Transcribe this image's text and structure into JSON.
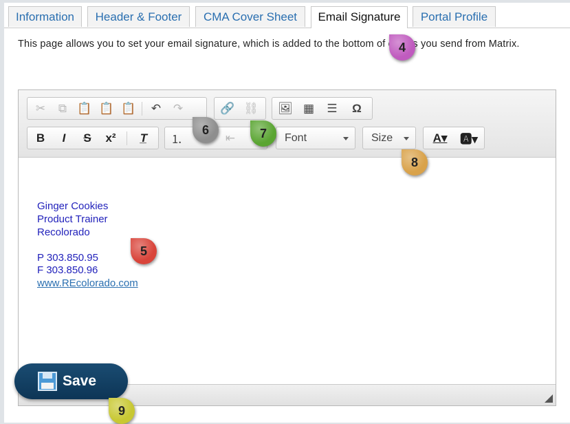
{
  "tabs": [
    {
      "label": "Information",
      "active": false
    },
    {
      "label": "Header & Footer",
      "active": false
    },
    {
      "label": "CMA Cover Sheet",
      "active": false
    },
    {
      "label": "Email Signature",
      "active": true
    },
    {
      "label": "Portal Profile",
      "active": false
    }
  ],
  "intro": "This page allows you to set your email signature, which is added to the bottom of emails you send from Matrix.",
  "toolbar": {
    "font_label": "Font",
    "size_label": "Size"
  },
  "signature": {
    "name": "Ginger Cookies",
    "title": "Product Trainer",
    "company": "Recolorado",
    "phone": "P 303.850.95",
    "fax": "F 303.850.96",
    "website": "www.REcolorado.com"
  },
  "save_label": "Save",
  "markers": [
    {
      "num": "4",
      "color": "#c05bbf"
    },
    {
      "num": "5",
      "color": "#d9443a"
    },
    {
      "num": "6",
      "color": "#8e8e8e"
    },
    {
      "num": "7",
      "color": "#5aa532"
    },
    {
      "num": "8",
      "color": "#d9a24a"
    },
    {
      "num": "9",
      "color": "#c8c832"
    }
  ]
}
